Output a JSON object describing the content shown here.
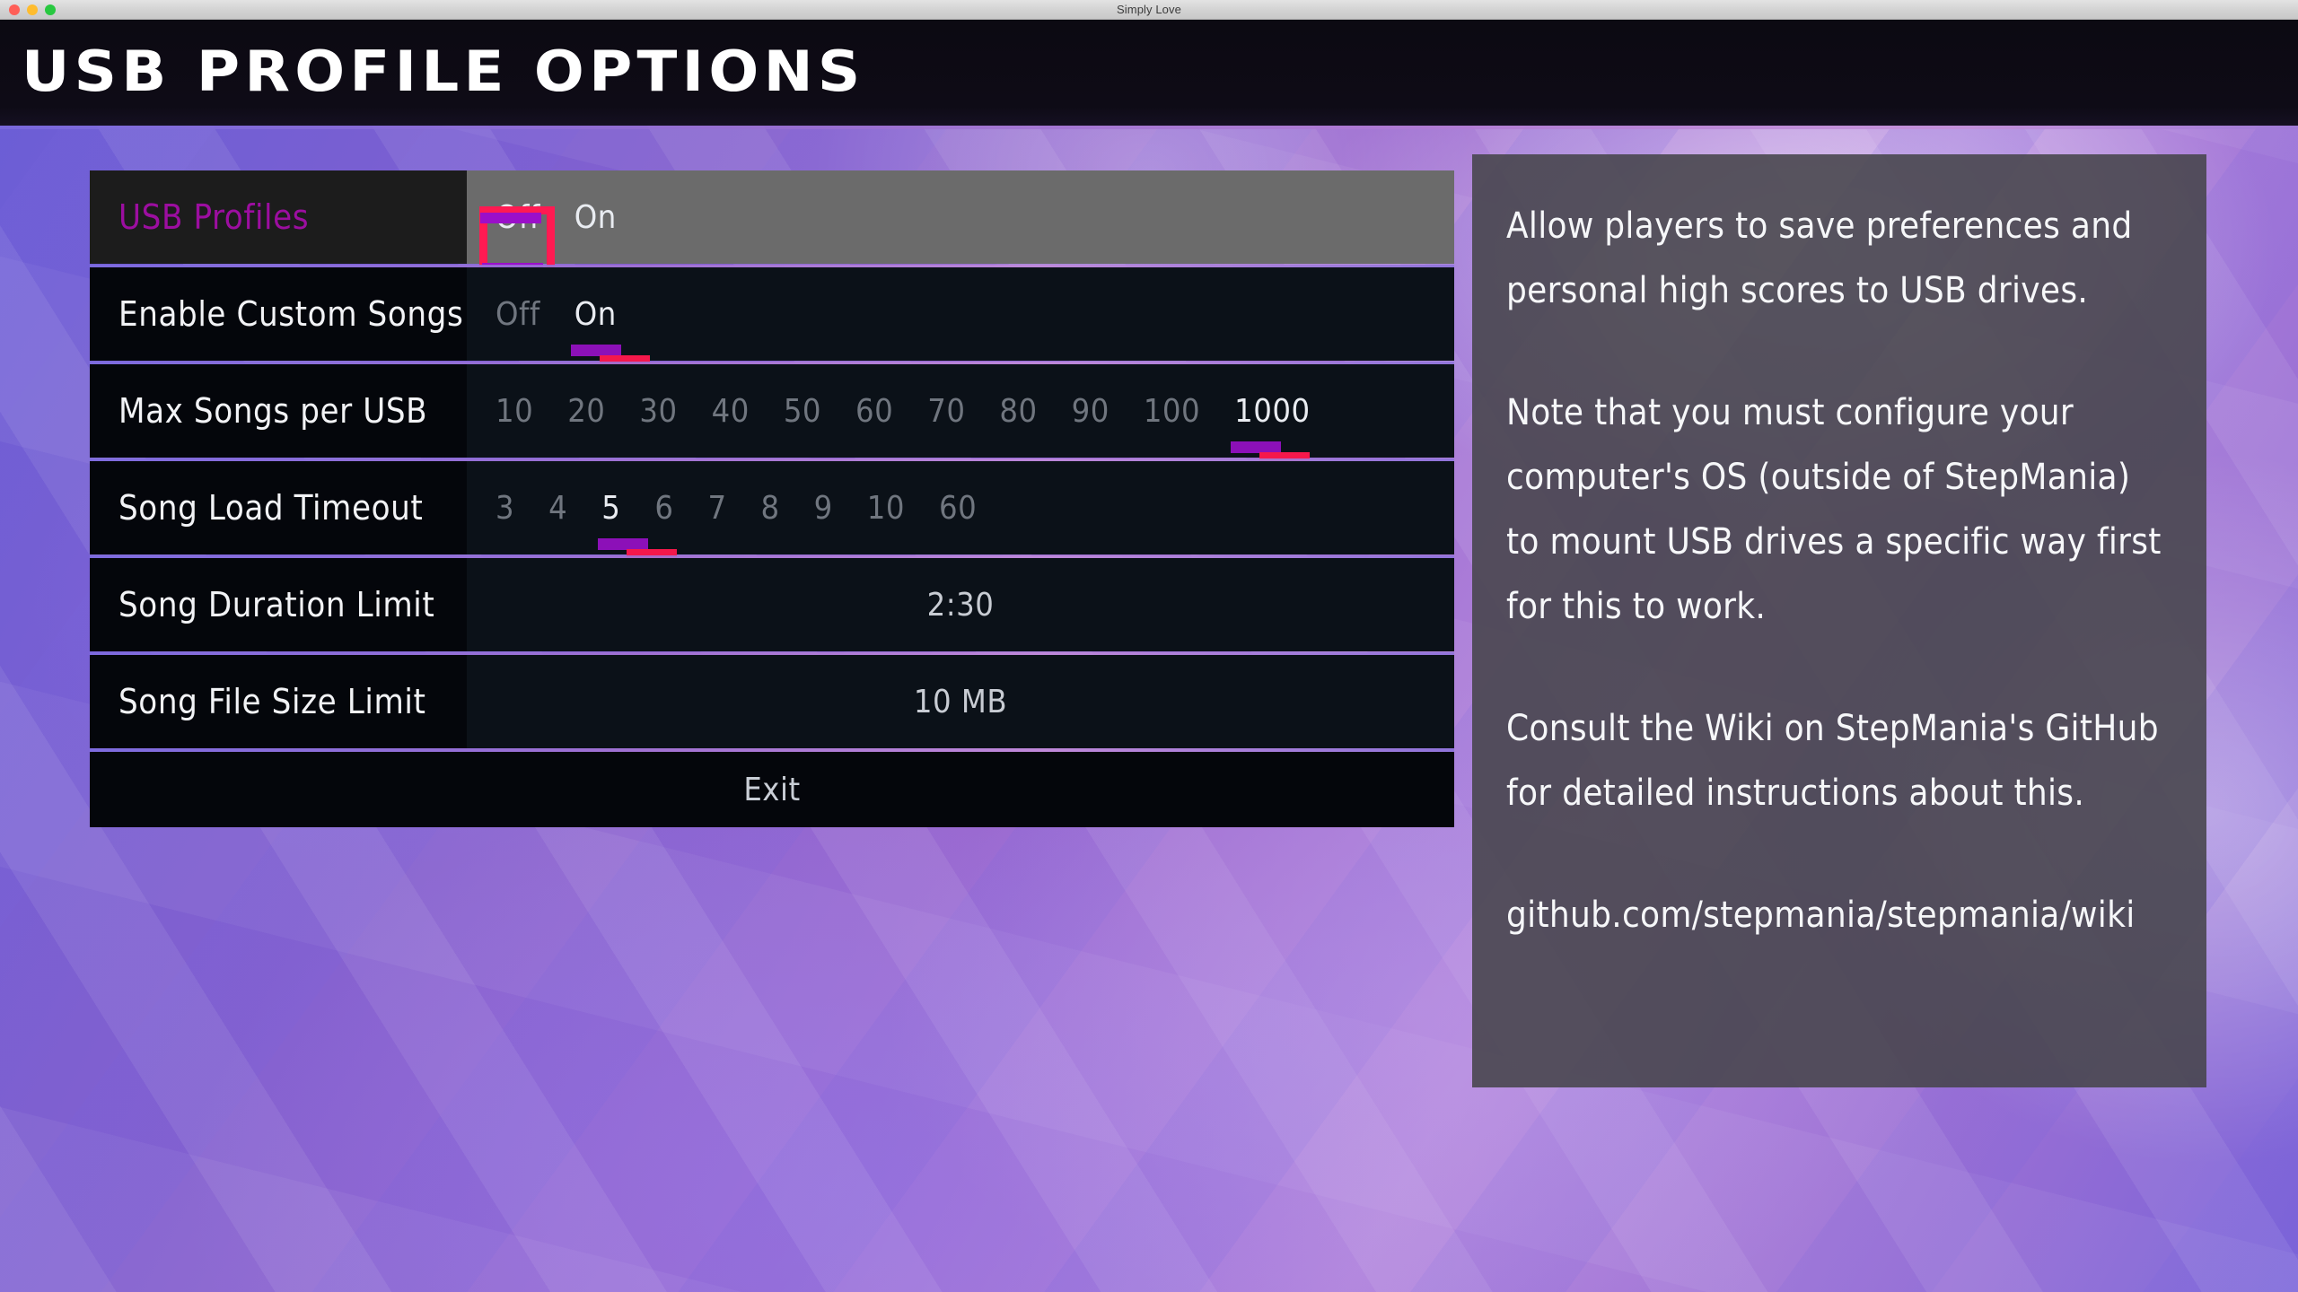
{
  "window": {
    "title": "Simply Love",
    "controls": [
      "close",
      "minimize",
      "maximize"
    ]
  },
  "header": {
    "screen_title": "USB Profile Options"
  },
  "colors": {
    "cursor_box": "#ff1a52",
    "player1_marker": "#8c10b8",
    "player2_marker": "#f5184b",
    "active_row_label": "#9c0ea0",
    "active_row_values_bg": "#6b6b6b",
    "row_bg": "#04060b",
    "values_bg": "#0b1118",
    "separator": "#a071d2"
  },
  "options": [
    {
      "name": "USB Profiles",
      "type": "choices",
      "active": true,
      "choices": [
        "Off",
        "On"
      ],
      "selected_index": 0,
      "cursor_index": 0
    },
    {
      "name": "Enable Custom Songs",
      "type": "choices",
      "active": false,
      "choices": [
        "Off",
        "On"
      ],
      "selected_index": 1,
      "cursor_index": null
    },
    {
      "name": "Max Songs per USB",
      "type": "choices",
      "active": false,
      "choices": [
        "10",
        "20",
        "30",
        "40",
        "50",
        "60",
        "70",
        "80",
        "90",
        "100",
        "1000"
      ],
      "selected_index": 10,
      "cursor_index": null
    },
    {
      "name": "Song Load Timeout",
      "type": "choices",
      "active": false,
      "choices": [
        "3",
        "4",
        "5",
        "6",
        "7",
        "8",
        "9",
        "10",
        "60"
      ],
      "selected_index": 2,
      "cursor_index": null
    },
    {
      "name": "Song Duration Limit",
      "type": "single",
      "active": false,
      "value": "2:30"
    },
    {
      "name": "Song File Size Limit",
      "type": "single",
      "active": false,
      "value": "10 MB"
    }
  ],
  "exit": {
    "label": "Exit"
  },
  "explanation": {
    "paragraphs": [
      "Allow players to save preferences and personal high scores to USB drives.",
      "Note that you must configure your computer's OS (outside of StepMania) to mount USB drives a specific way first for this to work.",
      "Consult the Wiki on StepMania's GitHub for detailed instructions about this.",
      "github.com/stepmania/stepmania/wiki"
    ]
  }
}
